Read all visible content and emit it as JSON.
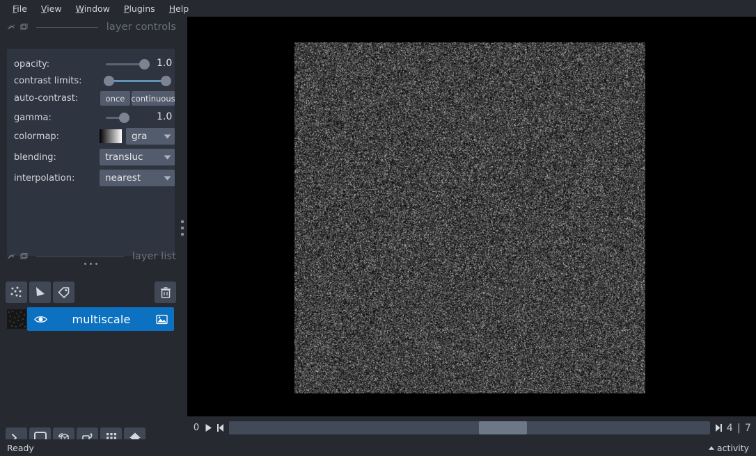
{
  "menu": {
    "items": [
      {
        "label": "File",
        "accel": "F"
      },
      {
        "label": "View",
        "accel": "V"
      },
      {
        "label": "Window",
        "accel": "W"
      },
      {
        "label": "Plugins",
        "accel": "P"
      },
      {
        "label": "Help",
        "accel": "H"
      }
    ]
  },
  "layer_controls": {
    "title": "layer controls",
    "opacity": {
      "label": "opacity:",
      "value": "1.0",
      "fraction": 1.0
    },
    "contrast_limits": {
      "label": "contrast limits:",
      "low_fraction": 0.0,
      "high_fraction": 1.0
    },
    "auto_contrast": {
      "label": "auto-contrast:",
      "once": "once",
      "continuous": "continuous"
    },
    "gamma": {
      "label": "gamma:",
      "value": "1.0",
      "fraction": 0.5
    },
    "colormap": {
      "label": "colormap:",
      "value": "gray",
      "truncated": "gra",
      "swatch_from": "#000000",
      "swatch_to": "#ffffff"
    },
    "blending": {
      "label": "blending:",
      "value": "translucent",
      "truncated": "transluc"
    },
    "interpolation": {
      "label": "interpolation:",
      "value": "nearest",
      "truncated": "nearest"
    }
  },
  "layer_list": {
    "title": "layer list",
    "buttons": [
      {
        "name": "new-points-layer",
        "icon": "points-icon"
      },
      {
        "name": "new-shapes-layer",
        "icon": "shapes-icon"
      },
      {
        "name": "new-labels-layer",
        "icon": "labels-tag-icon"
      }
    ],
    "delete_button": {
      "name": "delete-layer-button",
      "icon": "trash-icon"
    },
    "layers": [
      {
        "name": "multiscale",
        "visible": true,
        "selected": true,
        "type_icon": "image-icon"
      }
    ]
  },
  "viewer_buttons": [
    {
      "name": "console-button",
      "icon": "terminal-icon"
    },
    {
      "name": "ndisplay-toggle-button",
      "icon": "square-2d-icon"
    },
    {
      "name": "roll-dims-button",
      "icon": "cube-roll-icon"
    },
    {
      "name": "transpose-dims-button",
      "icon": "transpose-icon"
    },
    {
      "name": "grid-view-button",
      "icon": "grid-icon"
    },
    {
      "name": "reset-view-button",
      "icon": "home-icon"
    }
  ],
  "dims": {
    "axis_label": "0",
    "play_icon": "play-icon",
    "prev_icon": "step-back-icon",
    "next_icon": "step-forward-icon",
    "current": "4",
    "separator": "|",
    "total": "7",
    "handle_left_pct": 52,
    "handle_width_pct": 10
  },
  "status_bar": {
    "message": "Ready",
    "activity_label": "activity"
  },
  "colors": {
    "background": "#262930",
    "panel": "#2e3440",
    "widget": "#535c6c",
    "accent_blue": "#0c71c1",
    "slider_blue": "#5f93b8",
    "canvas": "#000000"
  }
}
